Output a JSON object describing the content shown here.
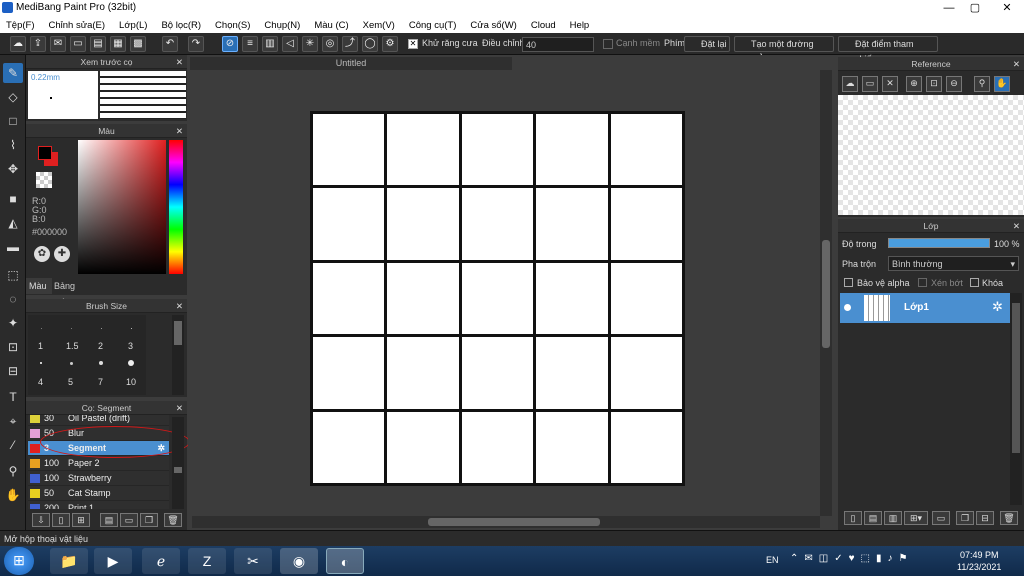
{
  "window": {
    "title": "MediBang Paint Pro (32bit)",
    "min": "—",
    "max": "▢",
    "close": "✕"
  },
  "menu": [
    "Tệp(F)",
    "Chỉnh sửa(E)",
    "Lớp(L)",
    "Bộ lọc(R)",
    "Chọn(S)",
    "Chụp(N)",
    "Màu (C)",
    "Xem(V)",
    "Công cụ(T)",
    "Cửa sổ(W)",
    "Cloud",
    "Help"
  ],
  "toolbar": {
    "antialias": "Khử răng cưa",
    "adjust": "Điều chỉnh",
    "adjust_value": "40",
    "edge": "Cạnh mềm",
    "pin": "Phím",
    "reset": "Đặt lại",
    "straight": "Tạo một đường thẳng",
    "ref": "Đặt điểm tham chiếu"
  },
  "preview": {
    "title": "Xem trước cọ",
    "size": "0.22mm"
  },
  "color": {
    "title": "Màu",
    "r": "R:0",
    "g": "G:0",
    "b": "B:0",
    "hex": "#000000",
    "tab1": "Màu",
    "tab2": "Bảng màu"
  },
  "brushsize": {
    "title": "Brush Size",
    "sizes": [
      "1",
      "1.5",
      "2",
      "3",
      "4",
      "5",
      "7",
      "10"
    ]
  },
  "brushes": {
    "title": "Cọ: Segment",
    "items": [
      {
        "n": "30",
        "l": "Oil Pastel (drift)",
        "c": "#ddd13a"
      },
      {
        "n": "50",
        "l": "Blur",
        "c": "#e4a0d8"
      },
      {
        "n": "3",
        "l": "Segment",
        "c": "#e02020"
      },
      {
        "n": "100",
        "l": "Paper 2",
        "c": "#e8a020"
      },
      {
        "n": "100",
        "l": "Strawberry",
        "c": "#4060d0"
      },
      {
        "n": "50",
        "l": "Cat Stamp",
        "c": "#e8d020"
      },
      {
        "n": "200",
        "l": "Print 1",
        "c": "#4060d0"
      }
    ]
  },
  "canvas": {
    "tab": "Untitled"
  },
  "reference": {
    "title": "Reference"
  },
  "layers": {
    "title": "Lớp",
    "opacity_label": "Độ trong",
    "opacity": "100 %",
    "blend_label": "Pha trộn",
    "blend": "Bình thường",
    "alpha": "Bảo vệ alpha",
    "clip": "Xén bớt",
    "lock": "Khóa",
    "layer1": "Lớp1"
  },
  "status": "Mở hộp thoại vật liệu",
  "taskbar": {
    "lang": "EN",
    "time": "07:49 PM",
    "date": "11/23/2021"
  }
}
